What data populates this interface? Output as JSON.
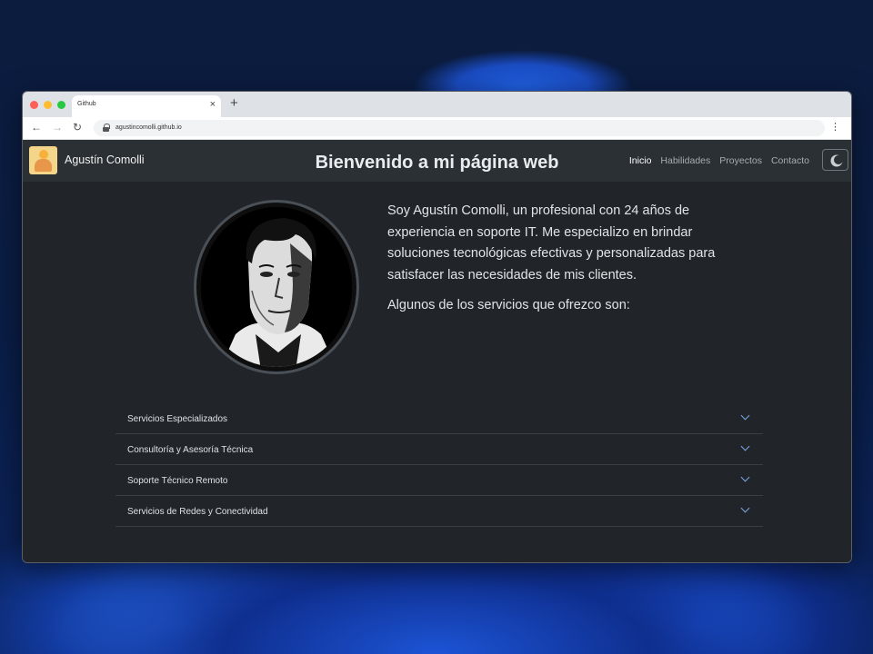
{
  "browser": {
    "tab_title": "Github",
    "tab_close": "×",
    "new_tab": "+",
    "url": "agustincomolli.github.io",
    "back": "←",
    "forward": "→",
    "reload": "↻",
    "menu": "⋮"
  },
  "navbar": {
    "brand": "Agustín Comolli",
    "links": [
      {
        "label": "Inicio",
        "active": true
      },
      {
        "label": "Habilidades",
        "active": false
      },
      {
        "label": "Proyectos",
        "active": false
      },
      {
        "label": "Contacto",
        "active": false
      }
    ],
    "theme_toggle_icon": "moon-icon"
  },
  "main": {
    "title": "Bienvenido a mi página web",
    "bio_paragraph": "Soy Agustín Comolli, un profesional con 24 años de experiencia en soporte IT. Me especializo en brindar soluciones tecnológicas efectivas y personalizadas para satisfacer las necesidades de mis clientes.",
    "services_intro": "Algunos de los servicios que ofrezco son:"
  },
  "accordion": {
    "items": [
      {
        "label": "Servicios Especializados"
      },
      {
        "label": "Consultoría y Asesoría Técnica"
      },
      {
        "label": "Soporte Técnico Remoto"
      },
      {
        "label": "Servicios de Redes y Conectividad"
      }
    ]
  },
  "colors": {
    "page_bg": "#212529",
    "navbar_bg": "#2b3035",
    "accent_chevron": "#7aa7e6"
  }
}
